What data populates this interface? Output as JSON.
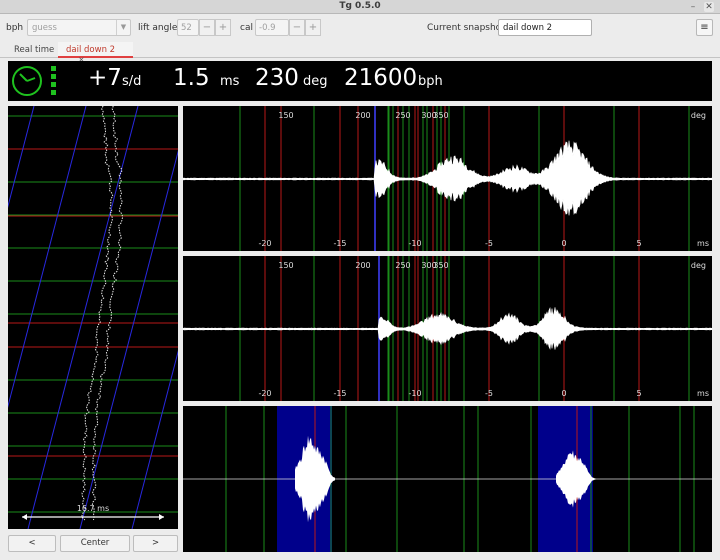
{
  "window": {
    "title": "Tg 0.5.0",
    "minimize": "–",
    "close": "✕"
  },
  "toolbar": {
    "bph_label": "bph",
    "bph_value": "guess",
    "lift_label": "lift angle",
    "lift_value": "52",
    "cal_label": "cal",
    "cal_value": "-0.9",
    "minus": "−",
    "plus": "+",
    "snapshot_label": "Current snapshot:",
    "snapshot_value": "dail down 2",
    "menu_icon": "≡"
  },
  "tabs": [
    {
      "label": "Real time",
      "active": false
    },
    {
      "label": "dail down 2",
      "active": true,
      "close": "×"
    }
  ],
  "readout": {
    "rate_value": "+7",
    "rate_unit": "s/d",
    "beat_value": "1.5",
    "beat_unit": "ms",
    "amp_value": "230",
    "amp_unit": "deg",
    "bph_value": "21600",
    "bph_unit": "bph"
  },
  "colors": {
    "accent_green": "#1fc21f",
    "grid_green": "#1a8c1a",
    "grid_red": "#b81818",
    "grid_blue": "#2828e0",
    "tick_blue": "#4040ff",
    "window_bg": "#ececec"
  },
  "paperstrip": {
    "scale_label": "16.7 ms"
  },
  "waveforms": {
    "deg_ticks": [
      "150",
      "200",
      "250",
      "300",
      "350"
    ],
    "deg_unit": "deg",
    "ms_ticks": [
      "-20",
      "-15",
      "-10",
      "-5",
      "0",
      "5"
    ],
    "ms_unit": "ms"
  },
  "nav": {
    "prev": "<",
    "center": "Center",
    "next": ">"
  }
}
